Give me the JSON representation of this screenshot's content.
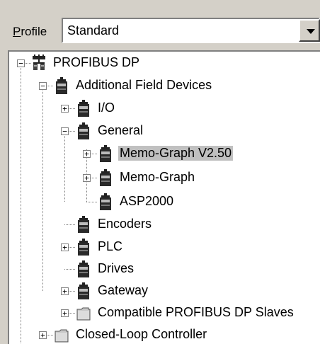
{
  "profile": {
    "label_underlined": "P",
    "label_rest": "rofile",
    "value": "Standard"
  },
  "tree": {
    "root": "PROFIBUS DP",
    "additional": "Additional Field Devices",
    "io": "I/O",
    "general": "General",
    "memo_v250": "Memo-Graph V2.50",
    "memo": "Memo-Graph",
    "asp": "ASP2000",
    "encoders": "Encoders",
    "plc": "PLC",
    "drives": "Drives",
    "gateway": "Gateway",
    "compat": "Compatible PROFIBUS DP Slaves",
    "closed_loop": "Closed-Loop Controller"
  },
  "selected": "Memo-Graph V2.50"
}
